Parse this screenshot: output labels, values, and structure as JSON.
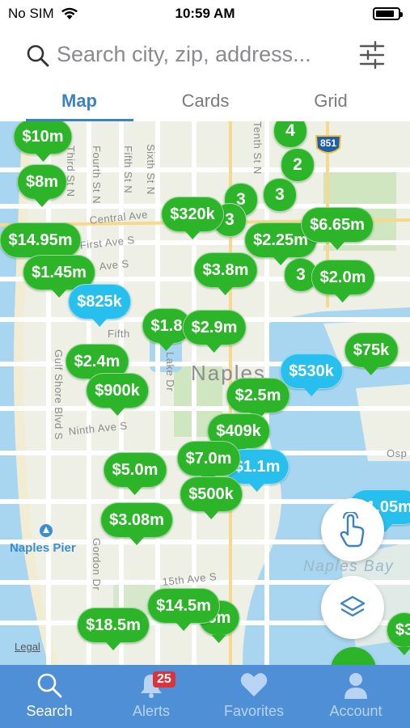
{
  "status_bar": {
    "carrier": "No SIM",
    "time": "10:59 AM",
    "battery_level": 0.85
  },
  "search": {
    "placeholder": "Search city, zip, address..."
  },
  "tabs": [
    {
      "label": "Map",
      "active": true
    },
    {
      "label": "Cards",
      "active": false
    },
    {
      "label": "Grid",
      "active": false
    }
  ],
  "map": {
    "streets": [
      "Third St N",
      "Fourth St N",
      "Fifth St N",
      "Sixth St N",
      "Tenth St N",
      "Central Ave",
      "First Ave S",
      "Ave S",
      "Fifth",
      "Lake Dr",
      "Ninth Ave S",
      "Gulf Shore Blvd S",
      "Gordon Dr",
      "15th Ave S",
      "Osp"
    ],
    "city_name": "Naples",
    "bay_name": "Naples Bay",
    "pier_name": "Naples Pier",
    "highway_shield": "851",
    "legal": "Legal",
    "clusters": [
      "4",
      "2",
      "3",
      "3",
      "3",
      "3"
    ],
    "price_pins": [
      {
        "price": "$10m",
        "color": "green"
      },
      {
        "price": "$8m",
        "color": "green"
      },
      {
        "price": "$320k",
        "color": "green"
      },
      {
        "price": "$14.95m",
        "color": "green"
      },
      {
        "price": "$2.25m",
        "color": "green"
      },
      {
        "price": "$6.65m",
        "color": "green"
      },
      {
        "price": "$3.8m",
        "color": "green"
      },
      {
        "price": "$1.45m",
        "color": "green"
      },
      {
        "price": "$2.0m",
        "color": "green"
      },
      {
        "price": "$825k",
        "color": "blue"
      },
      {
        "price": "$1.8",
        "color": "green"
      },
      {
        "price": "$2.9m",
        "color": "green"
      },
      {
        "price": "$75k",
        "color": "green"
      },
      {
        "price": "$530k",
        "color": "blue"
      },
      {
        "price": "$2.4m",
        "color": "green"
      },
      {
        "price": "$900k",
        "color": "green"
      },
      {
        "price": "$2.5m",
        "color": "green"
      },
      {
        "price": "$409k",
        "color": "green"
      },
      {
        "price": "$1.1m",
        "color": "blue"
      },
      {
        "price": "$7.0m",
        "color": "green"
      },
      {
        "price": "$5.0m",
        "color": "green"
      },
      {
        "price": "$500k",
        "color": "green"
      },
      {
        "price": "$3.08m",
        "color": "green"
      },
      {
        "price": "$1.05m",
        "color": "blue"
      },
      {
        "price": "$14.5m",
        "color": "green"
      },
      {
        "price": "$18.5m",
        "color": "green"
      },
      {
        "price": "5m",
        "color": "green"
      },
      {
        "price": "$3",
        "color": "green"
      }
    ]
  },
  "bottom_nav": [
    {
      "label": "Search",
      "icon": "search-icon",
      "active": true
    },
    {
      "label": "Alerts",
      "icon": "bell-icon",
      "badge": "25",
      "active": false
    },
    {
      "label": "Favorites",
      "icon": "heart-icon",
      "active": false
    },
    {
      "label": "Account",
      "icon": "person-icon",
      "active": false
    }
  ],
  "colors": {
    "accent": "#3b82c6",
    "pin_green": "#2db52a",
    "pin_blue": "#27c0ee",
    "tab_bar": "#4f8fd6"
  }
}
